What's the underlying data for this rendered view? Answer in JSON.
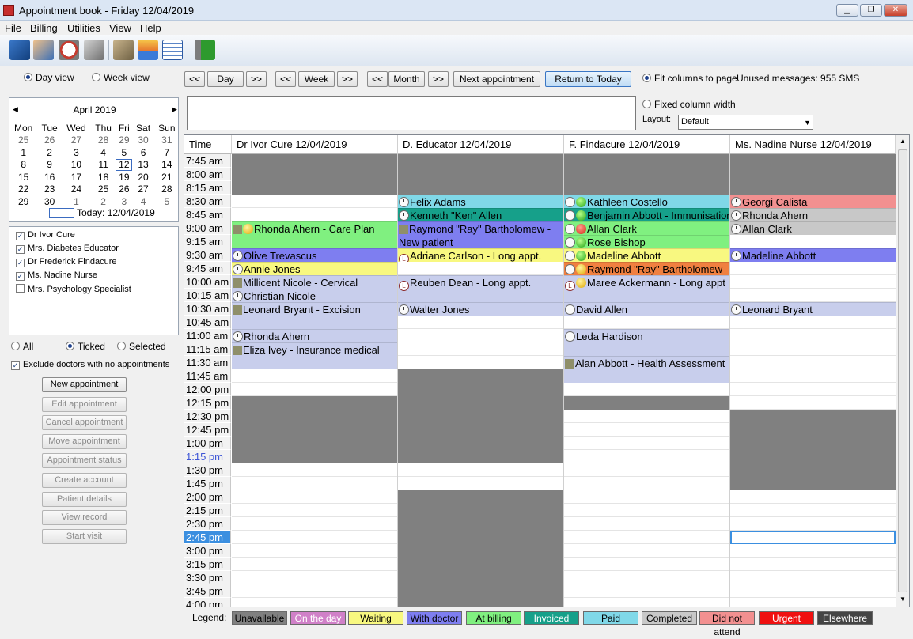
{
  "window": {
    "title": "Appointment book - Friday 12/04/2019",
    "min": "▁",
    "max": "❐",
    "close": "✕"
  },
  "menu": [
    "File",
    "Billing",
    "Utilities",
    "View",
    "Help"
  ],
  "toolbar": [
    "new-patient-icon",
    "patients-icon",
    "clock-icon",
    "records-icon",
    "billing-icon",
    "inbox-icon",
    "calendar-icon",
    "exit-icon"
  ],
  "view": {
    "day": "Day view",
    "week": "Week view"
  },
  "nav": {
    "prev": "<<",
    "next": ">>",
    "day": "Day",
    "week": "Week",
    "month": "Month",
    "next_appt": "Next appointment",
    "return": "Return to Today"
  },
  "options": {
    "fit": "Fit columns to page",
    "fixed": "Fixed column width",
    "layout_label": "Layout:",
    "layout_value": "Default",
    "sms": "Unused messages: 955 SMS"
  },
  "calendar": {
    "month": "April 2019",
    "days": [
      "Mon",
      "Tue",
      "Wed",
      "Thu",
      "Fri",
      "Sat",
      "Sun"
    ],
    "weeks": [
      [
        "25",
        "26",
        "27",
        "28",
        "29",
        "30",
        "31"
      ],
      [
        "1",
        "2",
        "3",
        "4",
        "5",
        "6",
        "7"
      ],
      [
        "8",
        "9",
        "10",
        "11",
        "12",
        "13",
        "14"
      ],
      [
        "15",
        "16",
        "17",
        "18",
        "19",
        "20",
        "21"
      ],
      [
        "22",
        "23",
        "24",
        "25",
        "26",
        "27",
        "28"
      ],
      [
        "29",
        "30",
        "1",
        "2",
        "3",
        "4",
        "5"
      ]
    ],
    "today": "Today: 12/04/2019"
  },
  "doctors": [
    {
      "name": "Dr Ivor Cure",
      "checked": true
    },
    {
      "name": "Mrs. Diabetes Educator",
      "checked": true
    },
    {
      "name": "Dr Frederick Findacure",
      "checked": true
    },
    {
      "name": "Ms. Nadine Nurse",
      "checked": true
    },
    {
      "name": "Mrs. Psychology Specialist",
      "checked": false
    }
  ],
  "filter": {
    "all": "All",
    "ticked": "Ticked",
    "selected": "Selected",
    "exclude": "Exclude doctors with no appointments"
  },
  "actions": [
    "New appointment",
    "Edit appointment",
    "Cancel appointment",
    "Move appointment",
    "Appointment status",
    "Create account",
    "Patient details",
    "View record",
    "Start visit"
  ],
  "grid": {
    "time_header": "Time",
    "columns": [
      "Dr Ivor Cure  12/04/2019",
      "D. Educator  12/04/2019",
      "F. Findacure  12/04/2019",
      "Ms. Nadine Nurse  12/04/2019"
    ],
    "times": [
      "7:45 am",
      "8:00 am",
      "8:15 am",
      "8:30 am",
      "8:45 am",
      "9:00 am",
      "9:15 am",
      "9:30 am",
      "9:45 am",
      "10:00 am",
      "10:15 am",
      "10:30 am",
      "10:45 am",
      "11:00 am",
      "11:15 am",
      "11:30 am",
      "11:45 am",
      "12:00 pm",
      "12:15 pm",
      "12:30 pm",
      "12:45 pm",
      "1:00 pm",
      "1:15 pm",
      "1:30 pm",
      "1:45 pm",
      "2:00 pm",
      "2:15 pm",
      "2:30 pm",
      "2:45 pm",
      "3:00 pm",
      "3:15 pm",
      "3:30 pm",
      "3:45 pm",
      "4:00 pm"
    ],
    "current_time": "2:45 pm",
    "appointments": [
      {
        "col": 0,
        "start": 5,
        "span": 2,
        "text": "Rhonda Ahern - Care Plan",
        "color": "#80f080",
        "icons": [
          "sq",
          "y"
        ]
      },
      {
        "col": 0,
        "start": 7,
        "span": 1,
        "text": "Olive Trevascus",
        "color": "#7e7ef0",
        "icons": [
          "ic"
        ]
      },
      {
        "col": 0,
        "start": 8,
        "span": 1,
        "text": "Annie Jones",
        "color": "#f8f880",
        "icons": [
          "ic"
        ]
      },
      {
        "col": 0,
        "start": 9,
        "span": 1,
        "text": "Millicent Nicole - Cervical",
        "color": "#c8ceec",
        "icons": [
          "sq"
        ]
      },
      {
        "col": 0,
        "start": 10,
        "span": 1,
        "text": "Christian Nicole",
        "color": "#c8ceec",
        "icons": [
          "ic"
        ]
      },
      {
        "col": 0,
        "start": 11,
        "span": 2,
        "text": "Leonard Bryant - Excision",
        "color": "#c8ceec",
        "icons": [
          "sq"
        ]
      },
      {
        "col": 0,
        "start": 13,
        "span": 1,
        "text": "Rhonda Ahern",
        "color": "#c8ceec",
        "icons": [
          "ic"
        ]
      },
      {
        "col": 0,
        "start": 14,
        "span": 2,
        "text": "Eliza Ivey - Insurance medical",
        "color": "#c8ceec",
        "icons": [
          "sq"
        ]
      },
      {
        "col": 1,
        "start": 3,
        "span": 1,
        "text": "Felix Adams",
        "color": "#80d8e8",
        "icons": [
          "ic"
        ]
      },
      {
        "col": 1,
        "start": 4,
        "span": 1,
        "text": "Kenneth \"Ken\" Allen",
        "color": "#16a08a",
        "icons": [
          "ic"
        ]
      },
      {
        "col": 1,
        "start": 5,
        "span": 2,
        "text": "Raymond \"Ray\" Bartholomew - New patient",
        "color": "#7e7ef0",
        "icons": [
          "sq"
        ],
        "wrap": true
      },
      {
        "col": 1,
        "start": 7,
        "span": 1,
        "text": "Adriane Carlson - Long appt.",
        "color": "#f8f880",
        "icons": [
          "L"
        ]
      },
      {
        "col": 1,
        "start": 9,
        "span": 2,
        "text": "Reuben Dean - Long appt.",
        "color": "#c8ceec",
        "icons": [
          "L"
        ]
      },
      {
        "col": 1,
        "start": 11,
        "span": 1,
        "text": "Walter Jones",
        "color": "#c8ceec",
        "icons": [
          "ic"
        ]
      },
      {
        "col": 2,
        "start": 3,
        "span": 1,
        "text": "Kathleen Costello",
        "color": "#80d8e8",
        "icons": [
          "ic",
          "g"
        ]
      },
      {
        "col": 2,
        "start": 4,
        "span": 1,
        "text": "Benjamin Abbott - Immunisation",
        "color": "#16a08a",
        "icons": [
          "ic",
          "g"
        ]
      },
      {
        "col": 2,
        "start": 5,
        "span": 1,
        "text": "Allan Clark",
        "color": "#80f080",
        "icons": [
          "ic",
          "r"
        ]
      },
      {
        "col": 2,
        "start": 6,
        "span": 1,
        "text": "Rose Bishop",
        "color": "#80f080",
        "icons": [
          "ic",
          "g"
        ]
      },
      {
        "col": 2,
        "start": 7,
        "span": 1,
        "text": "Madeline Abbott",
        "color": "#f8f880",
        "icons": [
          "ic",
          "g"
        ]
      },
      {
        "col": 2,
        "start": 8,
        "span": 1,
        "text": "Raymond \"Ray\" Bartholomew",
        "color": "#f08040",
        "icons": [
          "ic",
          "y"
        ]
      },
      {
        "col": 2,
        "start": 9,
        "span": 2,
        "text": "Maree Ackermann - Long appt",
        "color": "#c8ceec",
        "icons": [
          "L",
          "y"
        ]
      },
      {
        "col": 2,
        "start": 11,
        "span": 1,
        "text": "David Allen",
        "color": "#c8ceec",
        "icons": [
          "ic"
        ]
      },
      {
        "col": 2,
        "start": 13,
        "span": 2,
        "text": "Leda Hardison",
        "color": "#c8ceec",
        "icons": [
          "ic"
        ]
      },
      {
        "col": 2,
        "start": 15,
        "span": 2,
        "text": "Alan Abbott - Health Assessment",
        "color": "#c8ceec",
        "icons": [
          "sq"
        ],
        "wrap": true
      },
      {
        "col": 3,
        "start": 3,
        "span": 1,
        "text": "Georgi Calista",
        "color": "#f29090",
        "icons": [
          "ic"
        ]
      },
      {
        "col": 3,
        "start": 4,
        "span": 1,
        "text": "Rhonda Ahern",
        "color": "#c8c8c8",
        "icons": [
          "ic"
        ]
      },
      {
        "col": 3,
        "start": 5,
        "span": 1,
        "text": "Allan Clark",
        "color": "#c8c8c8",
        "icons": [
          "ic"
        ]
      },
      {
        "col": 3,
        "start": 7,
        "span": 1,
        "text": "Madeline Abbott",
        "color": "#7e7ef0",
        "icons": [
          "ic"
        ]
      },
      {
        "col": 3,
        "start": 11,
        "span": 1,
        "text": "Leonard Bryant",
        "color": "#c8ceec",
        "icons": [
          "ic"
        ]
      }
    ],
    "unavailable": [
      {
        "col": 0,
        "start": 0,
        "span": 3
      },
      {
        "col": 0,
        "start": 18,
        "span": 5
      },
      {
        "col": 1,
        "start": 0,
        "span": 3
      },
      {
        "col": 1,
        "start": 16,
        "span": 7
      },
      {
        "col": 1,
        "start": 25,
        "span": 9
      },
      {
        "col": 2,
        "start": 0,
        "span": 3
      },
      {
        "col": 2,
        "start": 18,
        "span": 1
      },
      {
        "col": 3,
        "start": 0,
        "span": 3
      },
      {
        "col": 3,
        "start": 19,
        "span": 6
      }
    ]
  },
  "legend_label": "Legend:",
  "legend": [
    {
      "label": "Unavailable",
      "bg": "#808080",
      "fg": "#000000"
    },
    {
      "label": "On the day",
      "bg": "#d080c8",
      "fg": "#ffffff"
    },
    {
      "label": "Waiting",
      "bg": "#f8f880",
      "fg": "#000000"
    },
    {
      "label": "With doctor",
      "bg": "#7e7ef0",
      "fg": "#000000"
    },
    {
      "label": "At billing",
      "bg": "#80f080",
      "fg": "#000000"
    },
    {
      "label": "Invoiced",
      "bg": "#16a08a",
      "fg": "#ffffff"
    },
    {
      "label": "Paid",
      "bg": "#80d8e8",
      "fg": "#000000"
    },
    {
      "label": "Completed",
      "bg": "#c8c8c8",
      "fg": "#000000"
    },
    {
      "label": "Did not attend",
      "bg": "#f29090",
      "fg": "#000000"
    },
    {
      "label": "Urgent",
      "bg": "#f01010",
      "fg": "#ffffff"
    },
    {
      "label": "Elsewhere",
      "bg": "#444444",
      "fg": "#ffffff"
    }
  ]
}
